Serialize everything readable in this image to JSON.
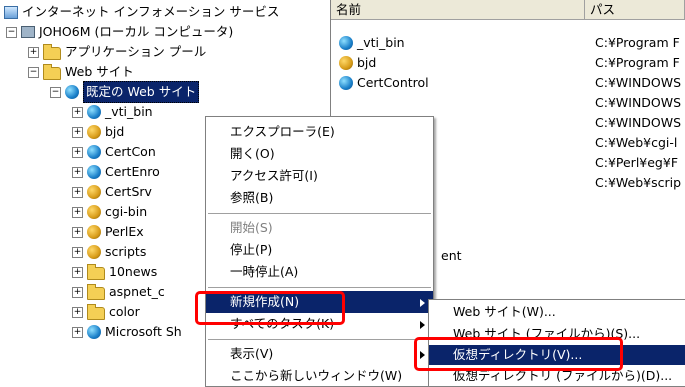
{
  "tree": {
    "root_label": "インターネット インフォメーション サービス",
    "computer_label": "JOHO6M (ローカル コンピュータ)",
    "app_pool_label": "アプリケーション プール",
    "websites_label": "Web サイト",
    "default_site_label": "既定の Web サイト",
    "children": [
      {
        "label": "_vti_bin",
        "icon": "globe-icon"
      },
      {
        "label": "bjd",
        "icon": "web-app-icon"
      },
      {
        "label": "CertCon",
        "icon": "globe-icon"
      },
      {
        "label": "CertEnro",
        "icon": "globe-icon"
      },
      {
        "label": "CertSrv",
        "icon": "web-app-icon"
      },
      {
        "label": "cgi-bin",
        "icon": "web-app-icon"
      },
      {
        "label": "PerlEx",
        "icon": "web-app-icon"
      },
      {
        "label": "scripts",
        "icon": "web-app-icon"
      },
      {
        "label": "10news",
        "icon": "folder-icon"
      },
      {
        "label": "aspnet_c",
        "icon": "folder-icon"
      },
      {
        "label": "color",
        "icon": "folder-icon"
      },
      {
        "label": "Microsoft Sh",
        "icon": "globe-icon"
      }
    ]
  },
  "list": {
    "col_name": "名前",
    "col_path": "パス",
    "rows": [
      {
        "name": "_vti_bin",
        "path": "C:¥Program F"
      },
      {
        "name": "bjd",
        "path": "C:¥Program F"
      },
      {
        "name": "CertControl",
        "path": "C:¥WINDOWS"
      },
      {
        "name": "",
        "path": "C:¥WINDOWS"
      },
      {
        "name": "",
        "path": "C:¥WINDOWS"
      },
      {
        "name": "",
        "path": "C:¥Web¥cgi-l"
      },
      {
        "name": "",
        "path": "C:¥Perl¥eg¥F"
      },
      {
        "name": "",
        "path": "C:¥Web¥scrip"
      }
    ],
    "partial_text": "ent"
  },
  "context_menu": {
    "items": [
      {
        "label": "エクスプローラ(E)",
        "disabled": false
      },
      {
        "label": "開く(O)",
        "disabled": false
      },
      {
        "label": "アクセス許可(I)",
        "disabled": false
      },
      {
        "label": "参照(B)",
        "disabled": false
      },
      {
        "label": "開始(S)",
        "disabled": true
      },
      {
        "label": "停止(P)",
        "disabled": false
      },
      {
        "label": "一時停止(A)",
        "disabled": false
      },
      {
        "label": "新規作成(N)",
        "disabled": false,
        "submenu": true
      },
      {
        "label": "すべてのタスク(K)",
        "disabled": false,
        "submenu": true
      },
      {
        "label": "表示(V)",
        "disabled": false,
        "submenu": true
      },
      {
        "label": "ここから新しいウィンドウ(W)",
        "disabled": false
      }
    ]
  },
  "submenu": {
    "items": [
      {
        "label": "Web サイト(W)..."
      },
      {
        "label": "Web サイト (ファイルから)(S)..."
      },
      {
        "label": "仮想ディレクトリ(V)..."
      },
      {
        "label": "仮想ディレクトリ (ファイルから)(D)..."
      }
    ]
  },
  "colors": {
    "highlight": "#0a246a",
    "annotation": "#ff0000",
    "header_bg": "#ece9d8"
  }
}
